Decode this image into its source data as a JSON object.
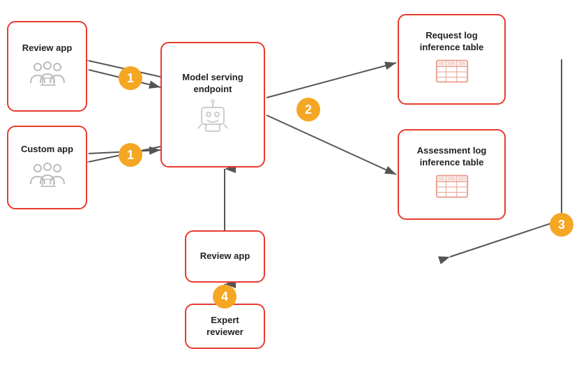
{
  "boxes": {
    "review_app_top": {
      "label": "Review app"
    },
    "custom_app": {
      "label": "Custom app"
    },
    "model_serving": {
      "label": "Model serving endpoint"
    },
    "request_log": {
      "label": "Request log inference table"
    },
    "assessment_log": {
      "label": "Assessment log inference table"
    },
    "review_app_bottom": {
      "label": "Review app"
    },
    "expert_reviewer": {
      "label": "Expert reviewer"
    }
  },
  "badges": {
    "badge1_top": "1",
    "badge1_bottom": "1",
    "badge2": "2",
    "badge3": "3",
    "badge4": "4"
  }
}
